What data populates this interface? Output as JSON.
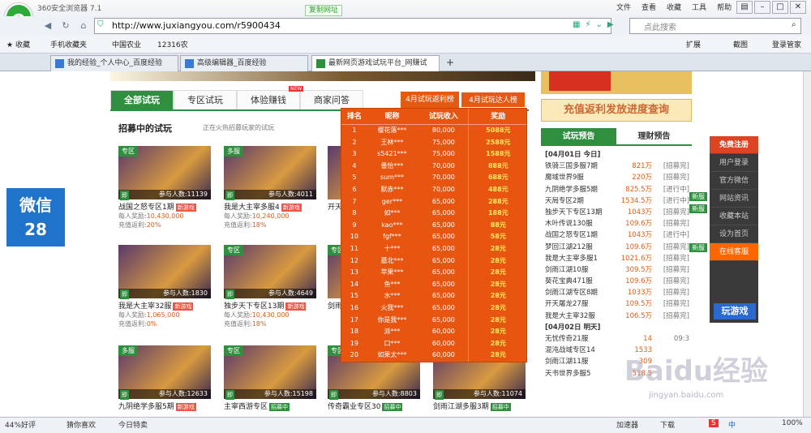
{
  "app": {
    "title": "360安全浏览器 7.1",
    "copy_url": "复制网址",
    "menu": [
      "文件",
      "查看",
      "收藏",
      "工具",
      "帮助"
    ],
    "url": "http://www.juxiangyou.com/r5900434",
    "search_placeholder": "点此搜索"
  },
  "favorites": {
    "label": "收藏",
    "items": [
      "手机收藏夹",
      "中国农业",
      "12316农"
    ],
    "right": [
      "扩展",
      "截图",
      "登录管家"
    ]
  },
  "tabs": [
    {
      "label": "我的经验_个人中心_百度经验"
    },
    {
      "label": "高级编辑器_百度经验"
    },
    {
      "label": "最新网页游戏试玩平台_网赚试"
    }
  ],
  "site": {
    "nav": [
      "全部试玩",
      "专区试玩",
      "体验赚钱",
      "商家问答"
    ],
    "new_badge": "NEW",
    "rank_tabs": [
      "4月试玩返利榜",
      "4月试玩达人榜"
    ],
    "section_title": "招募中的试玩",
    "section_sub": "正在火热招募玩家的试玩",
    "games": [
      {
        "badge": "专区",
        "name": "战国之怒专区1期",
        "tag": "新游戏",
        "players": "参与人数:11139",
        "reward": "10,430,000",
        "rate": "20%"
      },
      {
        "badge": "多服",
        "name": "我是大主宰多服4",
        "tag": "新游戏",
        "players": "参与人数:4011",
        "reward": "10,240,000",
        "rate": "18%"
      },
      {
        "badge": "",
        "name": "开天",
        "tag": "",
        "players": "",
        "reward": "",
        "rate": ""
      },
      {
        "badge": "",
        "name": "我是大主宰32服",
        "tag": "新游戏",
        "players": "参与人数:1830",
        "reward": "1,065,000",
        "rate": "0%"
      },
      {
        "badge": "专区",
        "name": "独步天下专区13期",
        "tag": "新游戏",
        "players": "参与人数:4649",
        "reward": "10,430,000",
        "rate": "18%"
      },
      {
        "badge": "专区",
        "name": "剑雨",
        "tag": "",
        "players": "",
        "reward": "",
        "rate": ""
      },
      {
        "badge": "多服",
        "name": "九阴绝学多服5期",
        "tag": "新游戏",
        "players": "参与人数:12633",
        "reward": "",
        "rate": ""
      },
      {
        "badge": "专区",
        "name": "主宰西游专区",
        "tag": "招募中",
        "players": "参与人数:15198",
        "reward": "",
        "rate": ""
      },
      {
        "badge": "专区",
        "name": "传奇霸业专区30",
        "tag": "招募中",
        "players": "参与人数:8803",
        "reward": "",
        "rate": ""
      },
      {
        "badge": "",
        "name": "剑雨江湖多服3期",
        "tag": "招募中",
        "players": "参与人数:11074",
        "reward": "",
        "rate": ""
      }
    ],
    "labels": {
      "play": "即",
      "reward": "每人奖励:",
      "rate": "充值返利:"
    },
    "rank_headers": [
      "排名",
      "昵称",
      "试玩收入",
      "奖励"
    ],
    "rank_rows": [
      [
        "1",
        "樱花落***",
        "80,000",
        "5088元"
      ],
      [
        "2",
        "王林***",
        "75,000",
        "2588元"
      ],
      [
        "3",
        "s5421***",
        "75,000",
        "1588元"
      ],
      [
        "4",
        "番恰***",
        "70,000",
        "888元"
      ],
      [
        "5",
        "sum***",
        "70,000",
        "688元"
      ],
      [
        "6",
        "默赤***",
        "70,000",
        "488元"
      ],
      [
        "7",
        "ger***",
        "65,000",
        "288元"
      ],
      [
        "8",
        "如***",
        "65,000",
        "188元"
      ],
      [
        "9",
        "kao***",
        "65,000",
        "88元"
      ],
      [
        "10",
        "fgf***",
        "65,000",
        "58元"
      ],
      [
        "11",
        "十***",
        "65,000",
        "28元"
      ],
      [
        "12",
        "墓北***",
        "65,000",
        "28元"
      ],
      [
        "13",
        "苹果***",
        "65,000",
        "28元"
      ],
      [
        "14",
        "鱼***",
        "65,000",
        "28元"
      ],
      [
        "15",
        "水***",
        "65,000",
        "28元"
      ],
      [
        "16",
        "火我***",
        "65,000",
        "28元"
      ],
      [
        "17",
        "你是我***",
        "65,000",
        "28元"
      ],
      [
        "18",
        "派***",
        "60,000",
        "28元"
      ],
      [
        "19",
        "口***",
        "60,000",
        "28元"
      ],
      [
        "20",
        "如果太***",
        "60,000",
        "28元"
      ]
    ],
    "weixin": [
      "微信",
      "28"
    ],
    "rebate_title": "充值返利发放进度查询",
    "preview_tabs": [
      "试玩预告",
      "理财预告"
    ],
    "preview": [
      {
        "h": "[04月01日 今日]"
      },
      {
        "n": "铁骑三国多服7期",
        "v": "821万",
        "s": "[招募完]"
      },
      {
        "n": "魔域世界9服",
        "v": "220万",
        "s": "[招募完]"
      },
      {
        "n": "九阴绝学多服5期",
        "v": "825.5万",
        "s": "[进行中]"
      },
      {
        "n": "天局专区2期",
        "v": "1534.5万",
        "s": "[进行中]"
      },
      {
        "n": "独步天下专区13期",
        "v": "1043万",
        "s": "[招募完]"
      },
      {
        "n": "木叶传说130服",
        "v": "109.6万",
        "s": "[招募完]"
      },
      {
        "n": "战国之怒专区1期",
        "v": "1043万",
        "s": "[进行中]"
      },
      {
        "n": "梦回江湖212服",
        "v": "109.6万",
        "s": "[招募完]"
      },
      {
        "n": "我是大主宰多服1",
        "v": "1021.6万",
        "s": "[招募完]"
      },
      {
        "n": "剑雨江湖10服",
        "v": "309.5万",
        "s": "[招募完]"
      },
      {
        "n": "葵花宝典471服",
        "v": "109.6万",
        "s": "[招募完]"
      },
      {
        "n": "剑雨江湖专区8期",
        "v": "1033万",
        "s": "[招募完]"
      },
      {
        "n": "开天屠龙27服",
        "v": "109.5万",
        "s": "[招募完]"
      },
      {
        "n": "我是大主宰32服",
        "v": "106.5万",
        "s": "[招募完]"
      },
      {
        "h": "[04月02日 明天]"
      },
      {
        "n": "无忧传奇21服",
        "v": "14",
        "s": "09:3"
      },
      {
        "n": "混沌战域专区14",
        "v": "1533",
        "s": ""
      },
      {
        "n": "剑雨江湖11服",
        "v": "309",
        "s": ""
      },
      {
        "n": "天书世界多服5",
        "v": "518.5",
        "s": ""
      }
    ],
    "new_tags": [
      "新服",
      "新服",
      "新服"
    ],
    "side": [
      "免费注册",
      "用户登录",
      "官方微信",
      "网站资讯",
      "收藏本站",
      "设为首页",
      "在线客服"
    ],
    "wanyouxi": "玩游戏"
  },
  "status": {
    "left": [
      "44%好评",
      "猜你喜欢",
      "今日特卖"
    ],
    "right": [
      "加速器",
      "下载",
      "中",
      "100%"
    ]
  },
  "watermark": {
    "brand": "Baidu经验",
    "url": "jingyan.baidu.com"
  }
}
